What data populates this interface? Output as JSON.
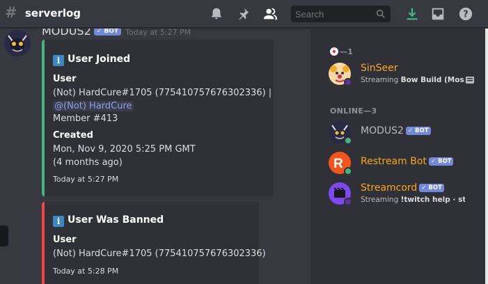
{
  "header": {
    "channel_name": "serverlog",
    "search_placeholder": "Search"
  },
  "author": {
    "name": "MODUS2",
    "bot_tag": "✓ BOT",
    "timestamp": "Today at 5:27 PM"
  },
  "embeds": [
    {
      "title": "User Joined",
      "color": "#43b581",
      "fields": [
        {
          "name": "User",
          "lines": [
            "(Not) HardCure#1705 (775410757676302336) |",
            "@(Not) HardCure",
            "Member #413"
          ]
        },
        {
          "name": "Created",
          "lines": [
            "Mon, Nov 9, 2020 5:25 PM GMT",
            "(4 months ago)"
          ]
        }
      ],
      "footer": "Today at 5:27 PM"
    },
    {
      "title": "User Was Banned",
      "color": "#f04747",
      "fields": [
        {
          "name": "User",
          "lines": [
            "(Not) HardCure#1705 (775410757676302336)"
          ]
        }
      ],
      "footer": "Today at 5:28 PM"
    }
  ],
  "members": {
    "group1_header": "—1",
    "online_header": "ONLINE—3",
    "list": [
      {
        "name": "SinSeer",
        "color": "#f7a731",
        "status": "Streaming",
        "activity": "Bow Build (Mos..."
      },
      {
        "name": "MODUS2",
        "color": "#b9bbbe",
        "bot_tag": "✓ BOT"
      },
      {
        "name": "Restream Bot",
        "color": "#faa61a",
        "bot_tag": "✓ BOT"
      },
      {
        "name": "Streamcord",
        "color": "#faa61a",
        "bot_tag": "✓ BOT",
        "status": "Streaming",
        "activity": "!twitch help · strea..."
      }
    ]
  },
  "colors": {
    "background": "#36393f",
    "sidebar": "#2f3136",
    "online_status": "#43b581",
    "streaming_status": "#593695",
    "download_icon": "#43b581",
    "blurple": "#7289da"
  }
}
